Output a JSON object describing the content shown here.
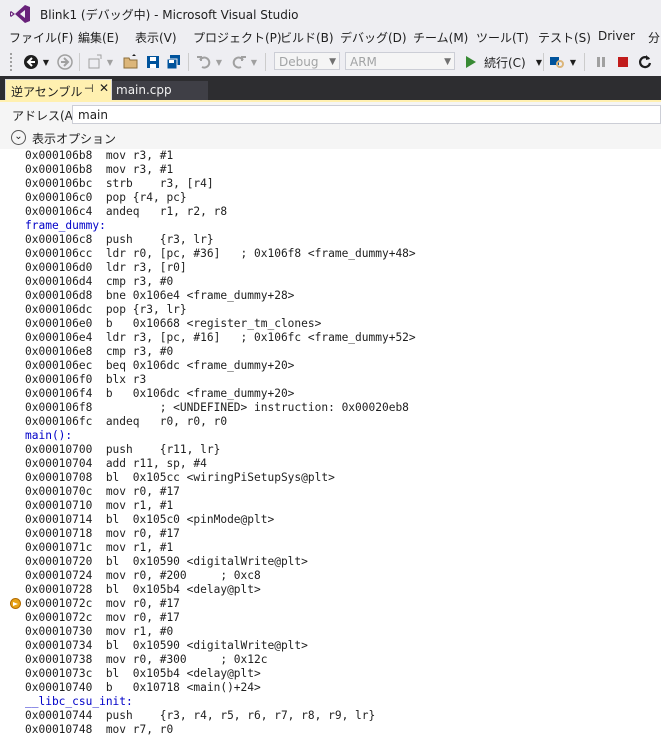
{
  "window": {
    "title": "Blink1 (デバッグ中) - Microsoft Visual Studio"
  },
  "menu": [
    "ファイル(F)",
    "編集(E)",
    "表示(V)",
    "プロジェクト(P)",
    "ビルド(B)",
    "デバッグ(D)",
    "チーム(M)",
    "ツール(T)",
    "テスト(S)",
    "Driver",
    "分"
  ],
  "toolbar": {
    "config": "Debug",
    "platform": "ARM",
    "run_label": "続行(C)",
    "icons": [
      "back-icon",
      "forward-icon",
      "new-project-icon",
      "open-icon",
      "save-icon",
      "save-all-icon",
      "undo-icon",
      "redo-icon",
      "continue-icon",
      "find-icon",
      "pause-icon",
      "stop-icon",
      "restart-icon"
    ]
  },
  "tabs": {
    "active": "逆アセンブル",
    "inactive": "main.cpp",
    "pin_glyph": "⊣",
    "close_glyph": "✕"
  },
  "address": {
    "label": "アドレス(A):",
    "value": "main"
  },
  "options": {
    "label": "表示オプション"
  },
  "colors": {
    "tab_active": "#fff0b0",
    "tab_strip": "#2d2d30",
    "label_blue": "#0000c8",
    "breakpoint": "#e8a317"
  },
  "lines": [
    {
      "text": "0x000106b8  mov r3, #1",
      "type": "code"
    },
    {
      "text": "0x000106b8  mov r3, #1",
      "type": "code"
    },
    {
      "text": "0x000106bc  strb    r3, [r4]",
      "type": "code"
    },
    {
      "text": "0x000106c0  pop {r4, pc}",
      "type": "code"
    },
    {
      "text": "0x000106c4  andeq   r1, r2, r8",
      "type": "code"
    },
    {
      "text": "frame_dummy:",
      "type": "label"
    },
    {
      "text": "0x000106c8  push    {r3, lr}",
      "type": "code"
    },
    {
      "text": "0x000106cc  ldr r0, [pc, #36]   ; 0x106f8 <frame_dummy+48>",
      "type": "code"
    },
    {
      "text": "0x000106d0  ldr r3, [r0]",
      "type": "code"
    },
    {
      "text": "0x000106d4  cmp r3, #0",
      "type": "code"
    },
    {
      "text": "0x000106d8  bne 0x106e4 <frame_dummy+28>",
      "type": "code"
    },
    {
      "text": "0x000106dc  pop {r3, lr}",
      "type": "code"
    },
    {
      "text": "0x000106e0  b   0x10668 <register_tm_clones>",
      "type": "code"
    },
    {
      "text": "0x000106e4  ldr r3, [pc, #16]   ; 0x106fc <frame_dummy+52>",
      "type": "code"
    },
    {
      "text": "0x000106e8  cmp r3, #0",
      "type": "code"
    },
    {
      "text": "0x000106ec  beq 0x106dc <frame_dummy+20>",
      "type": "code"
    },
    {
      "text": "0x000106f0  blx r3",
      "type": "code"
    },
    {
      "text": "0x000106f4  b   0x106dc <frame_dummy+20>",
      "type": "code"
    },
    {
      "text": "0x000106f8          ; <UNDEFINED> instruction: 0x00020eb8",
      "type": "code"
    },
    {
      "text": "0x000106fc  andeq   r0, r0, r0",
      "type": "code"
    },
    {
      "text": "main():",
      "type": "label"
    },
    {
      "text": "0x00010700  push    {r11, lr}",
      "type": "code"
    },
    {
      "text": "0x00010704  add r11, sp, #4",
      "type": "code"
    },
    {
      "text": "0x00010708  bl  0x105cc <wiringPiSetupSys@plt>",
      "type": "code"
    },
    {
      "text": "0x0001070c  mov r0, #17",
      "type": "code"
    },
    {
      "text": "0x00010710  mov r1, #1",
      "type": "code"
    },
    {
      "text": "0x00010714  bl  0x105c0 <pinMode@plt>",
      "type": "code"
    },
    {
      "text": "0x00010718  mov r0, #17",
      "type": "code"
    },
    {
      "text": "0x0001071c  mov r1, #1",
      "type": "code"
    },
    {
      "text": "0x00010720  bl  0x10590 <digitalWrite@plt>",
      "type": "code"
    },
    {
      "text": "0x00010724  mov r0, #200     ; 0xc8",
      "type": "code"
    },
    {
      "text": "0x00010728  bl  0x105b4 <delay@plt>",
      "type": "code"
    },
    {
      "text": "0x0001072c  mov r0, #17",
      "type": "code",
      "current": true
    },
    {
      "text": "0x0001072c  mov r0, #17",
      "type": "code"
    },
    {
      "text": "0x00010730  mov r1, #0",
      "type": "code"
    },
    {
      "text": "0x00010734  bl  0x10590 <digitalWrite@plt>",
      "type": "code"
    },
    {
      "text": "0x00010738  mov r0, #300     ; 0x12c",
      "type": "code"
    },
    {
      "text": "0x0001073c  bl  0x105b4 <delay@plt>",
      "type": "code"
    },
    {
      "text": "0x00010740  b   0x10718 <main()+24>",
      "type": "code"
    },
    {
      "text": "__libc_csu_init:",
      "type": "label"
    },
    {
      "text": "0x00010744  push    {r3, r4, r5, r6, r7, r8, r9, lr}",
      "type": "code"
    },
    {
      "text": "0x00010748  mov r7, r0",
      "type": "code"
    }
  ]
}
